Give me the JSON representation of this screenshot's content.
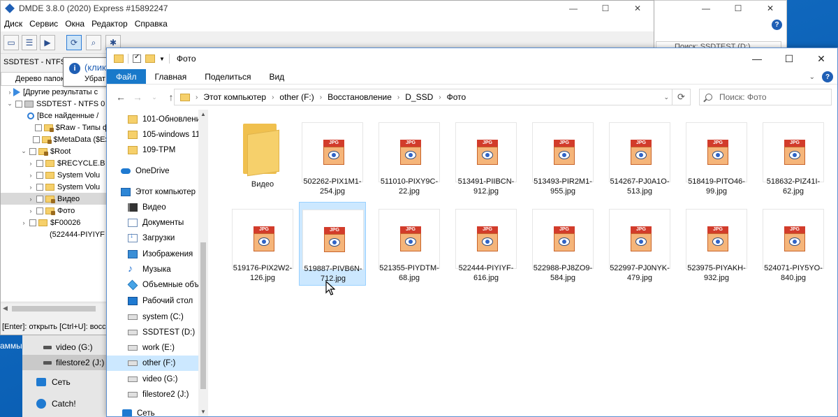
{
  "dmde": {
    "title": "DMDE 3.8.0 (2020) Express #15892247",
    "menu": [
      "Диск",
      "Сервис",
      "Окна",
      "Редактор",
      "Справка"
    ],
    "status_line": "SSDTEST - NTFS 0",
    "tree_header": "Дерево папок",
    "tooltip_title": "(клик",
    "tooltip_text": "Убрат",
    "tree": [
      {
        "label": "[Другие результаты с",
        "arrow": "›",
        "icon": "play"
      },
      {
        "label": "SSDTEST - NTFS 0",
        "arrow": "⌄",
        "icon": "drive"
      },
      {
        "label": "[Все найденные / ",
        "arrow": "",
        "icon": "search"
      },
      {
        "label": "$Raw - Типы ф",
        "arrow": "",
        "icon": "lock"
      },
      {
        "label": "$MetaData ($Ex",
        "arrow": "",
        "icon": "lock"
      },
      {
        "label": "$Root",
        "arrow": "⌄",
        "icon": "lock"
      },
      {
        "label": "$RECYCLE.B",
        "arrow": "›",
        "icon": "fold"
      },
      {
        "label": "System Volu",
        "arrow": "›",
        "icon": "fold"
      },
      {
        "label": "System Volu",
        "arrow": "›",
        "icon": "fold"
      },
      {
        "label": "Видео",
        "arrow": "›",
        "icon": "lock"
      },
      {
        "label": "Фото",
        "arrow": "›",
        "icon": "lock"
      },
      {
        "label": "$F00026",
        "arrow": "›",
        "icon": "fold"
      },
      {
        "label": "(522444-PIYIYF",
        "arrow": "",
        "icon": ""
      }
    ],
    "footer": "[Enter]: открыть  [Ctrl+U]: восс"
  },
  "background_window": {
    "search_placeholder": "Поиск: SSDTEST (D:)"
  },
  "side_panel": {
    "left_text": "аммы",
    "drives": [
      {
        "label": "video (G:)"
      },
      {
        "label": "filestore2 (J:)"
      }
    ],
    "network": "Сеть",
    "catch": "Catch!"
  },
  "explorer": {
    "title": "Фото",
    "ribbon_tabs": [
      "Файл",
      "Главная",
      "Поделиться",
      "Вид"
    ],
    "breadcrumb": [
      "Этот компьютер",
      "other (F:)",
      "Восстановление",
      "D_SSD",
      "Фото"
    ],
    "search_placeholder": "Поиск: Фото",
    "nav": [
      {
        "label": "101-Обновлени",
        "icon": "fold"
      },
      {
        "label": "105-windows 11",
        "icon": "fold"
      },
      {
        "label": "109-TPM",
        "icon": "fold"
      },
      {
        "label": "OneDrive",
        "icon": "cloud"
      },
      {
        "label": "Этот компьютер",
        "icon": "pc"
      },
      {
        "label": "Видео",
        "icon": "video"
      },
      {
        "label": "Документы",
        "icon": "doc"
      },
      {
        "label": "Загрузки",
        "icon": "down"
      },
      {
        "label": "Изображения",
        "icon": "pics"
      },
      {
        "label": "Музыка",
        "icon": "music"
      },
      {
        "label": "Объемные объ",
        "icon": "cube"
      },
      {
        "label": "Рабочий стол",
        "icon": "desk"
      },
      {
        "label": "system (C:)",
        "icon": "drivesys"
      },
      {
        "label": "SSDTEST (D:)",
        "icon": "drive"
      },
      {
        "label": "work (E:)",
        "icon": "drive"
      },
      {
        "label": "other (F:)",
        "icon": "drive"
      },
      {
        "label": "video (G:)",
        "icon": "drive"
      },
      {
        "label": "filestore2 (J:)",
        "icon": "drive"
      },
      {
        "label": "Сеть",
        "icon": "net"
      }
    ],
    "files": [
      {
        "name": "Видео",
        "type": "folder"
      },
      {
        "name": "502262-PIX1M1-254.jpg",
        "type": "jpg"
      },
      {
        "name": "511010-PIXY9C-22.jpg",
        "type": "jpg"
      },
      {
        "name": "513491-PIIBCN-912.jpg",
        "type": "jpg"
      },
      {
        "name": "513493-PIR2M1-955.jpg",
        "type": "jpg"
      },
      {
        "name": "514267-PJ0A1O-513.jpg",
        "type": "jpg"
      },
      {
        "name": "518419-PITO46-99.jpg",
        "type": "jpg"
      },
      {
        "name": "518632-PIZ41I-62.jpg",
        "type": "jpg"
      },
      {
        "name": "519176-PIX2W2-126.jpg",
        "type": "jpg"
      },
      {
        "name": "519887-PIVB6N-712.jpg",
        "type": "jpg"
      },
      {
        "name": "521355-PIYDTM-68.jpg",
        "type": "jpg"
      },
      {
        "name": "522444-PIYIYF-616.jpg",
        "type": "jpg"
      },
      {
        "name": "522988-PJ8ZO9-584.jpg",
        "type": "jpg"
      },
      {
        "name": "522997-PJ0NYK-479.jpg",
        "type": "jpg"
      },
      {
        "name": "523975-PIYAKH-932.jpg",
        "type": "jpg"
      },
      {
        "name": "524071-PIY5YO-840.jpg",
        "type": "jpg"
      }
    ],
    "selected_file": "519887-PIVB6N-712.jpg",
    "badge_text": "JPG"
  },
  "colors": {
    "accent": "#1979ca",
    "selection": "#cce8ff",
    "desktop": "#0a5fb4"
  }
}
